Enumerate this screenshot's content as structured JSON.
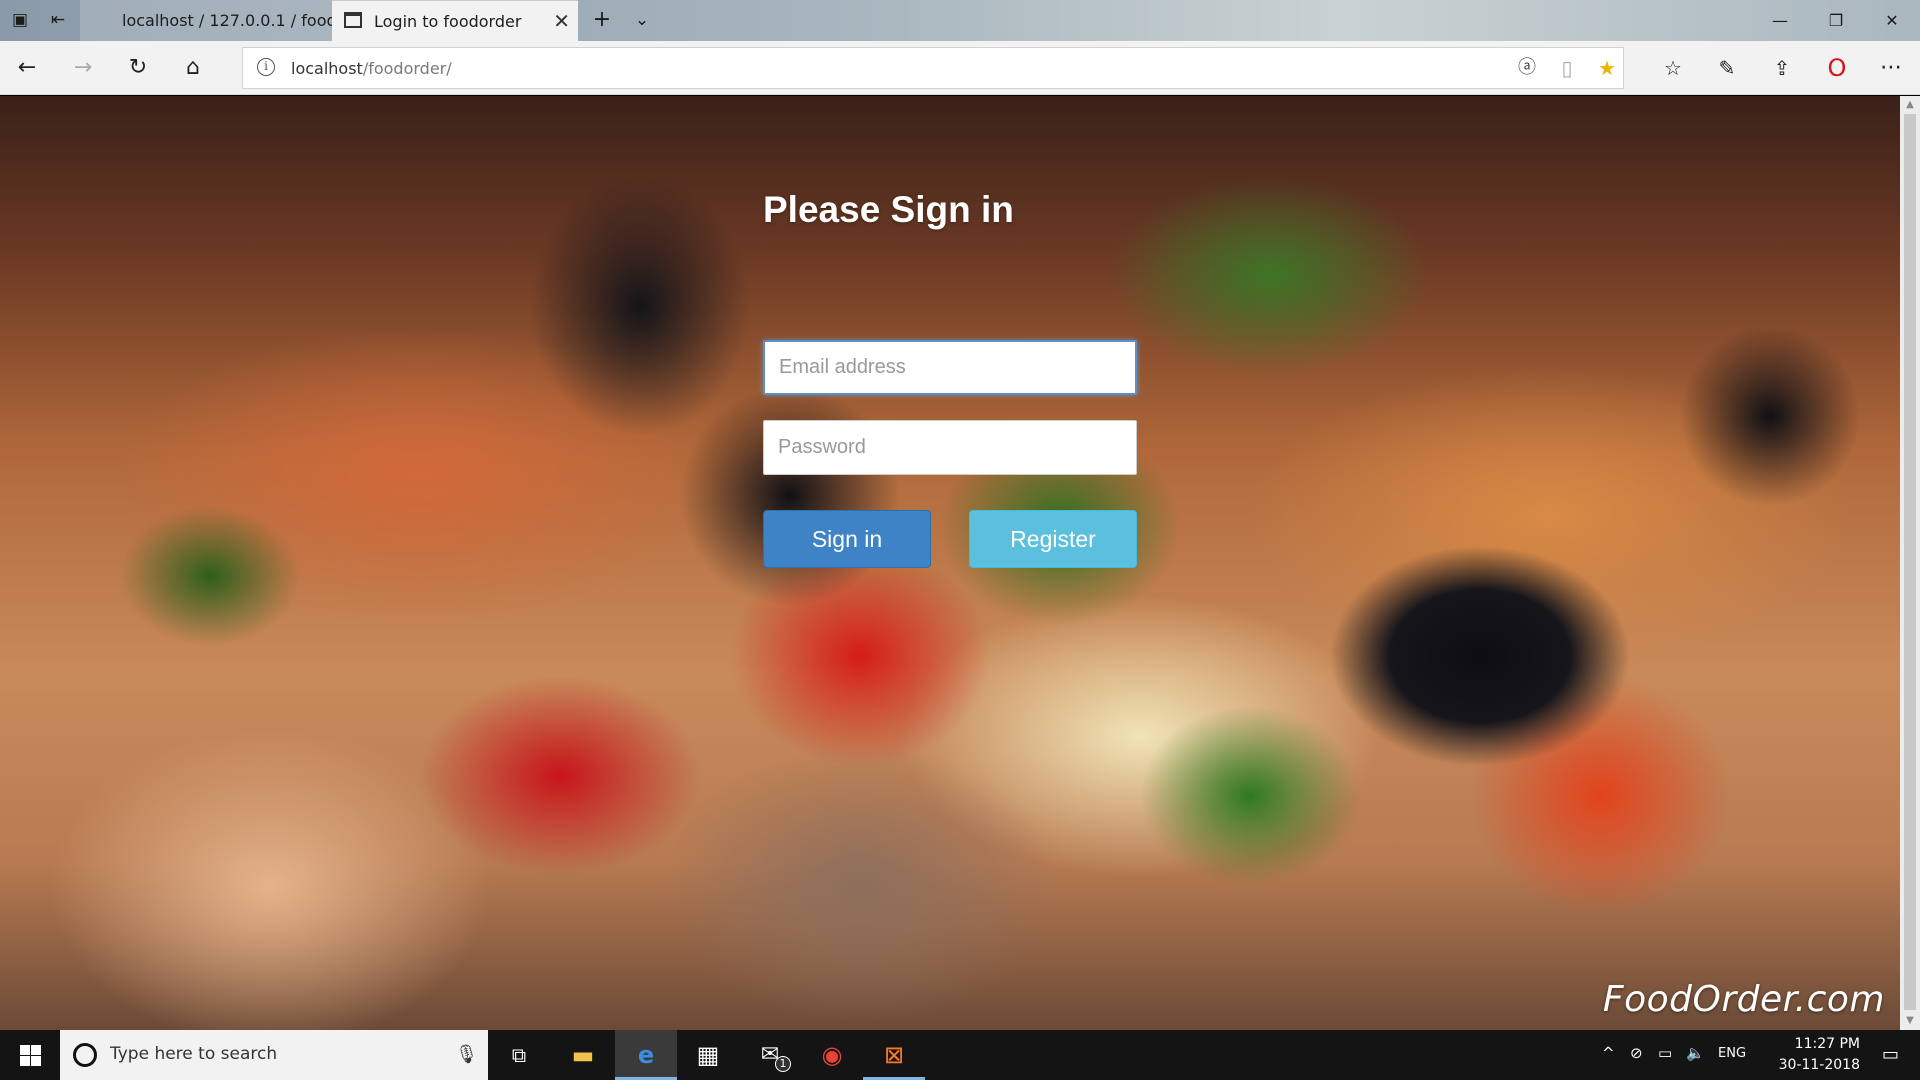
{
  "browser": {
    "tabs": [
      {
        "label": "localhost / 127.0.0.1 / foodc"
      },
      {
        "label": "Login to foodorder"
      }
    ],
    "address": {
      "host": "localhost",
      "path": "/foodorder/"
    }
  },
  "page": {
    "heading": "Please Sign in",
    "email_placeholder": "Email address",
    "password_placeholder": "Password",
    "signin_label": "Sign in",
    "register_label": "Register",
    "brand": "FoodOrder.com"
  },
  "taskbar": {
    "search_placeholder": "Type here to search",
    "mail_badge": "1",
    "language": "ENG",
    "time": "11:27 PM",
    "date": "30-11-2018"
  },
  "colors": {
    "signin_button": "#3d83c6",
    "register_button": "#5bc0de",
    "active_taskbar_indicator": "#7fb4e3"
  },
  "icons": [
    "tab-actions-icon",
    "back-icon",
    "forward-icon",
    "refresh-icon",
    "home-icon",
    "info-icon",
    "read-aloud-icon",
    "reading-view-icon",
    "favorite-star-icon",
    "favorites-list-icon",
    "pen-icon",
    "share-icon",
    "opera-icon",
    "more-icon"
  ]
}
